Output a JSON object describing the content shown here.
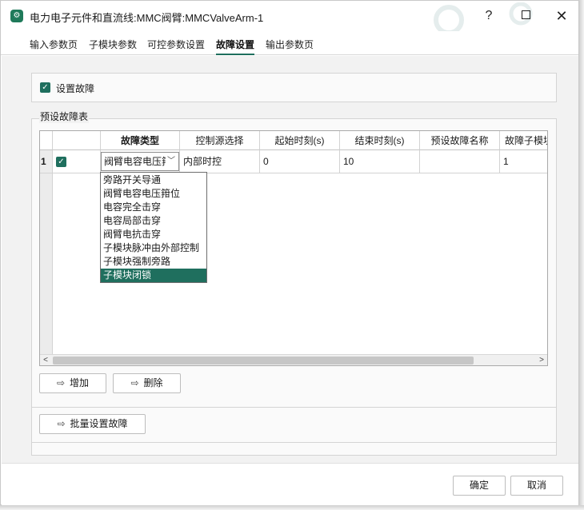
{
  "window": {
    "title": "电力电子元件和直流线:MMC阀臂:MMCValveArm-1",
    "help_label": "?",
    "close_label": "✕"
  },
  "tabs": [
    {
      "label": "输入参数页",
      "active": false
    },
    {
      "label": "子模块参数",
      "active": false
    },
    {
      "label": "可控参数设置",
      "active": false
    },
    {
      "label": "故障设置",
      "active": true
    },
    {
      "label": "输出参数页",
      "active": false
    }
  ],
  "fault_settings": {
    "enable_label": "设置故障",
    "enable_checked": true,
    "group_title": "预设故障表"
  },
  "table": {
    "columns": [
      "",
      "",
      "故障类型",
      "控制源选择",
      "起始时刻(s)",
      "结束时刻(s)",
      "预设故障名称",
      "故障子模块"
    ],
    "rows": [
      {
        "index": "1",
        "checked": true,
        "fault_type": "阀臂电容电压箝",
        "control_source": "内部时控",
        "start_time": "0",
        "end_time": "10",
        "fault_name": "",
        "fault_submodule": "1"
      }
    ]
  },
  "fault_type_options": [
    "旁路开关导通",
    "阀臂电容电压箝位",
    "电容完全击穿",
    "电容局部击穿",
    "阀臂电抗击穿",
    "子模块脉冲由外部控制",
    "子模块强制旁路",
    "子模块闭锁"
  ],
  "fault_type_selected_index": 7,
  "buttons": {
    "add": "增加",
    "delete": "删除",
    "batch": "批量设置故障",
    "ok": "确定",
    "cancel": "取消"
  },
  "colors": {
    "accent": "#1f6f5e"
  }
}
